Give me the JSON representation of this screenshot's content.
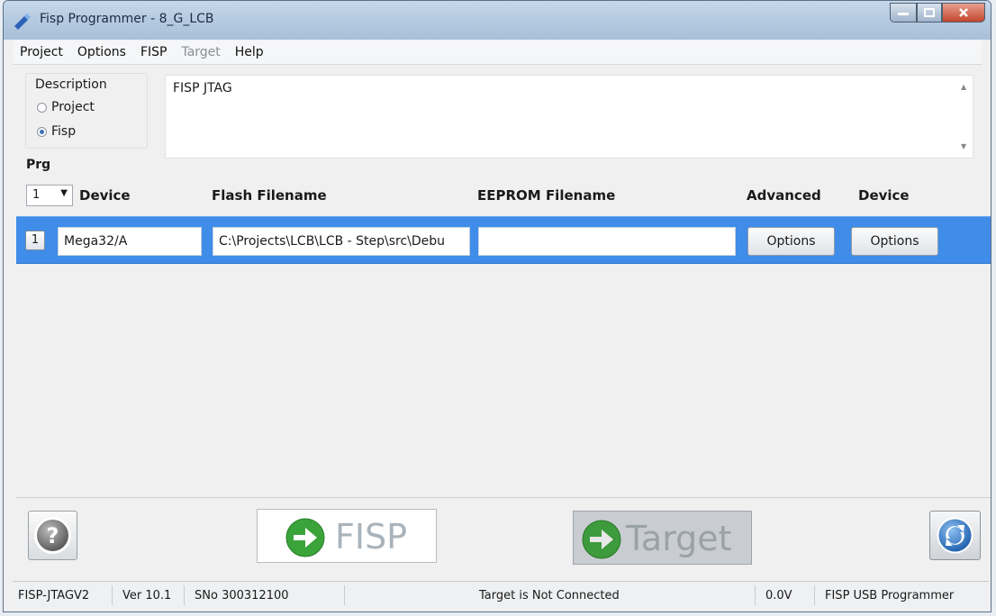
{
  "window": {
    "title": "Fisp Programmer - 8_G_LCB"
  },
  "menu": {
    "items": [
      {
        "label": "Project",
        "enabled": true
      },
      {
        "label": "Options",
        "enabled": true
      },
      {
        "label": "FISP",
        "enabled": true
      },
      {
        "label": "Target",
        "enabled": false
      },
      {
        "label": "Help",
        "enabled": true
      }
    ]
  },
  "description": {
    "group_label": "Description",
    "options": [
      "Project",
      "Fisp"
    ],
    "selected": "Fisp",
    "text": "FISP JTAG"
  },
  "programs": {
    "label": "Prg",
    "selected_count": "1",
    "headers": {
      "device": "Device",
      "flash": "Flash Filename",
      "eeprom": "EEPROM Filename",
      "advanced": "Advanced",
      "device_opts": "Device"
    },
    "rows": [
      {
        "num": "1",
        "device": "Mega32/A",
        "flash": "C:\\Projects\\LCB\\LCB - Step\\src\\Debu",
        "eeprom": "",
        "advanced_btn": "Options",
        "device_btn": "Options"
      }
    ]
  },
  "buttons": {
    "fisp_label": "FISP",
    "target_label": "Target"
  },
  "status": {
    "interface": "FISP-JTAGV2",
    "version": "Ver 10.1",
    "serial": "SNo 300312100",
    "target": "Target is Not Connected",
    "voltage": "0.0V",
    "product": "FISP USB Programmer"
  },
  "colors": {
    "row_highlight": "#3f8de8",
    "arrow_green": "#3aa33a"
  }
}
